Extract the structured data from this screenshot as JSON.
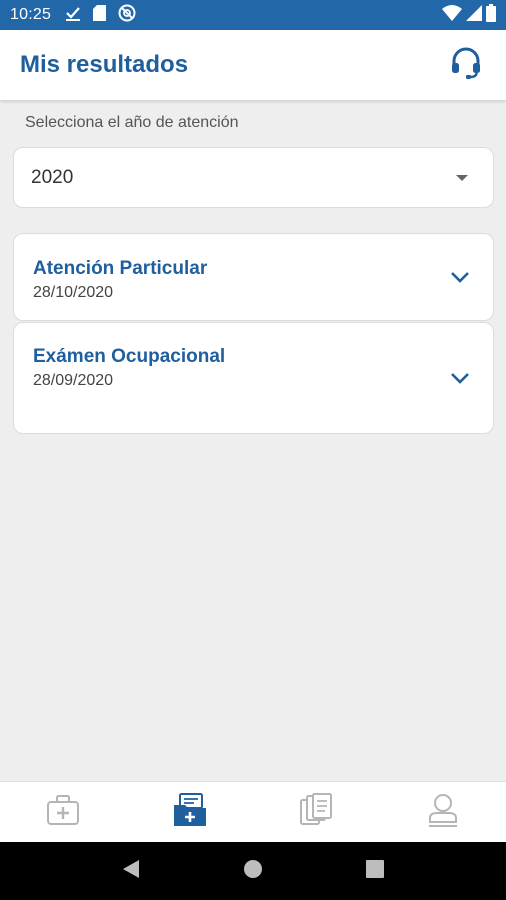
{
  "status_bar": {
    "time": "10:25",
    "icons": [
      "check-icon",
      "sim-card-icon",
      "no-data-icon",
      "wifi-icon",
      "signal-icon",
      "battery-icon"
    ]
  },
  "header": {
    "title": "Mis resultados",
    "support_icon": "headset-icon"
  },
  "filter": {
    "label": "Selecciona el año de atención",
    "selected_year": "2020"
  },
  "results": [
    {
      "title": "Atención Particular",
      "date": "28/10/2020"
    },
    {
      "title": "Exámen Ocupacional",
      "date": "28/09/2020"
    }
  ],
  "bottom_nav": {
    "items": [
      {
        "icon": "medical-kit-icon",
        "active": false
      },
      {
        "icon": "medical-folder-icon",
        "active": true
      },
      {
        "icon": "documents-icon",
        "active": false
      },
      {
        "icon": "profile-icon",
        "active": false
      }
    ]
  },
  "colors": {
    "primary": "#1f5f9e",
    "status_bar": "#2268a8",
    "background": "#eeeeee",
    "inactive_icon": "#b5b5b5"
  }
}
